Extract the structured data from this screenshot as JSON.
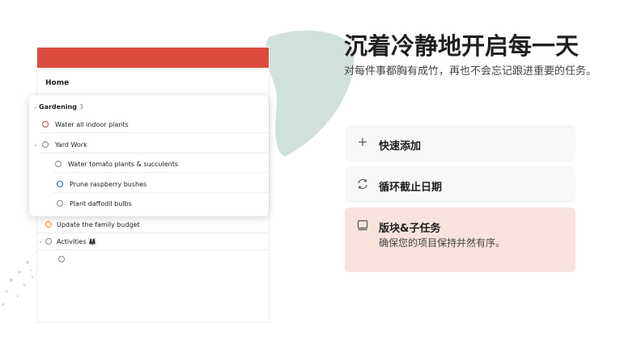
{
  "app": {
    "header_title": "Home",
    "group": {
      "title": "Gardening",
      "count": "3"
    },
    "tasks": [
      {
        "label": "Water all indoor plants",
        "priority_color": "#d1453b"
      },
      {
        "label": "Yard Work",
        "collapsible": true
      },
      {
        "label": "Water tomato plants & succulents"
      },
      {
        "label": "Prune raspberry bushes",
        "priority_color": "#246fe0"
      },
      {
        "label": "Plant daffodil bulbs"
      },
      {
        "label": "Update the family budget",
        "priority_color": "#eb8909"
      },
      {
        "label": "Activities 👨‍👩‍👧",
        "collapsible": true
      }
    ]
  },
  "hero": {
    "title": "沉着冷静地开启每一天",
    "subtitle": "对每件事都胸有成竹，再也不会忘记跟进重要的任务。"
  },
  "features": [
    {
      "icon": "plus-icon",
      "label": "快速添加",
      "description": ""
    },
    {
      "icon": "recurring-icon",
      "label": "循环截止日期",
      "description": ""
    },
    {
      "icon": "board-icon",
      "label": "版块&子任务",
      "description": "确保您的项目保持井然有序。",
      "active": true
    }
  ],
  "colors": {
    "brand_red": "#dc4c3e",
    "active_feature_bg": "#f9e1dc",
    "feature_bg": "#f7f7f7"
  }
}
